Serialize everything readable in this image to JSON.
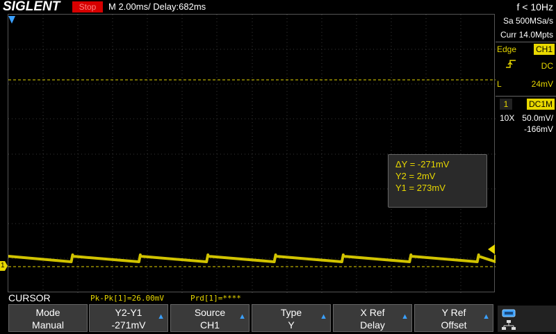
{
  "topbar": {
    "brand": "SIGLENT",
    "run_state": "Stop",
    "timebase": "M 2.00ms/ Delay:682ms",
    "frequency": "f < 10Hz"
  },
  "acquisition": {
    "sample_rate": "Sa 500MSa/s",
    "memory": "Curr 14.0Mpts"
  },
  "trigger": {
    "type": "Edge",
    "source": "CH1",
    "slope_icon": "rising-edge-icon",
    "coupling": "DC",
    "level_label": "L",
    "level": "24mV"
  },
  "channel": {
    "number": "1",
    "coupling": "DC1M",
    "probe": "10X",
    "scale": "50.0mV/",
    "offset": "-166mV",
    "marker_label": "1",
    "color": "#e8d800"
  },
  "cursor_readout": {
    "delta_y": "ΔY = -271mV",
    "y2": "Y2 = 2mV",
    "y1": "Y1 = 273mV"
  },
  "measurements": {
    "title": "CURSOR",
    "pkpk": "Pk-Pk[1]=26.00mV",
    "prd": "Prd[1]=****"
  },
  "softkeys": [
    {
      "line1": "Mode",
      "line2": "Manual",
      "arrow": false
    },
    {
      "line1": "Y2-Y1",
      "line2": "-271mV",
      "arrow": true
    },
    {
      "line1": "Source",
      "line2": "CH1",
      "arrow": true
    },
    {
      "line1": "Type",
      "line2": "Y",
      "arrow": true
    },
    {
      "line1": "X Ref",
      "line2": "Delay",
      "arrow": true
    },
    {
      "line1": "Y Ref",
      "line2": "Offset",
      "arrow": true
    }
  ],
  "colors": {
    "trace": "#e8d800",
    "cursor_line": "#e8d800",
    "run_stop_bg": "#d60000",
    "accent_blue": "#3aa0ff"
  }
}
